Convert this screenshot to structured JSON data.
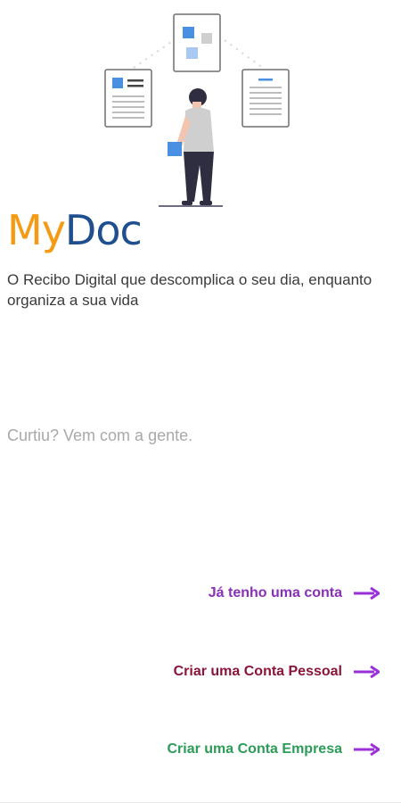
{
  "brand": {
    "part1": "My",
    "part2": "Doc"
  },
  "tagline": "O Recibo Digital que descomplica o seu dia, enquanto organiza a sua vida",
  "cta_text": "Curtiu? Vem com a gente.",
  "actions": [
    {
      "label": "Já tenho uma conta"
    },
    {
      "label": "Criar uma Conta Pessoal"
    },
    {
      "label": "Criar uma Conta Empresa"
    }
  ],
  "colors": {
    "brand_orange": "#f59a12",
    "brand_blue": "#1f4f8f",
    "arrow_purple": "#9b30d9",
    "login_purple": "#8a2fb8",
    "personal_red": "#8b1538",
    "business_green": "#2b9c57"
  },
  "icons": [
    "document-icon",
    "person-illustration",
    "arrow-right-icon"
  ]
}
